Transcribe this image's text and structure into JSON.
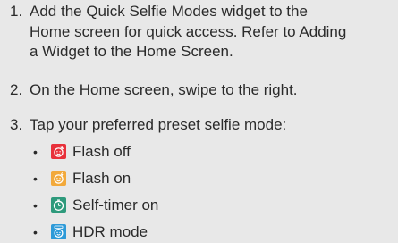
{
  "steps": [
    {
      "number": "1.",
      "lines": [
        "Add the Quick Selfie Modes widget to the",
        "Home screen for quick access. Refer to Adding",
        "a Widget to the Home Screen."
      ]
    },
    {
      "number": "2.",
      "lines": [
        "On the Home screen, swipe to the right."
      ]
    },
    {
      "number": "3.",
      "lines": [
        "Tap your preferred preset selfie mode:"
      ]
    }
  ],
  "modes": [
    {
      "bullet": "•",
      "label": "Flash off",
      "icon": "selfie-flash-off-icon",
      "color": "#e8303a"
    },
    {
      "bullet": "•",
      "label": "Flash on",
      "icon": "selfie-flash-on-icon",
      "color": "#f2a93b"
    },
    {
      "bullet": "•",
      "label": "Self-timer on",
      "icon": "selfie-timer-icon",
      "color": "#2e9a7c"
    },
    {
      "bullet": "•",
      "label": "HDR mode",
      "icon": "selfie-hdr-icon",
      "color": "#2d9ad8"
    }
  ]
}
